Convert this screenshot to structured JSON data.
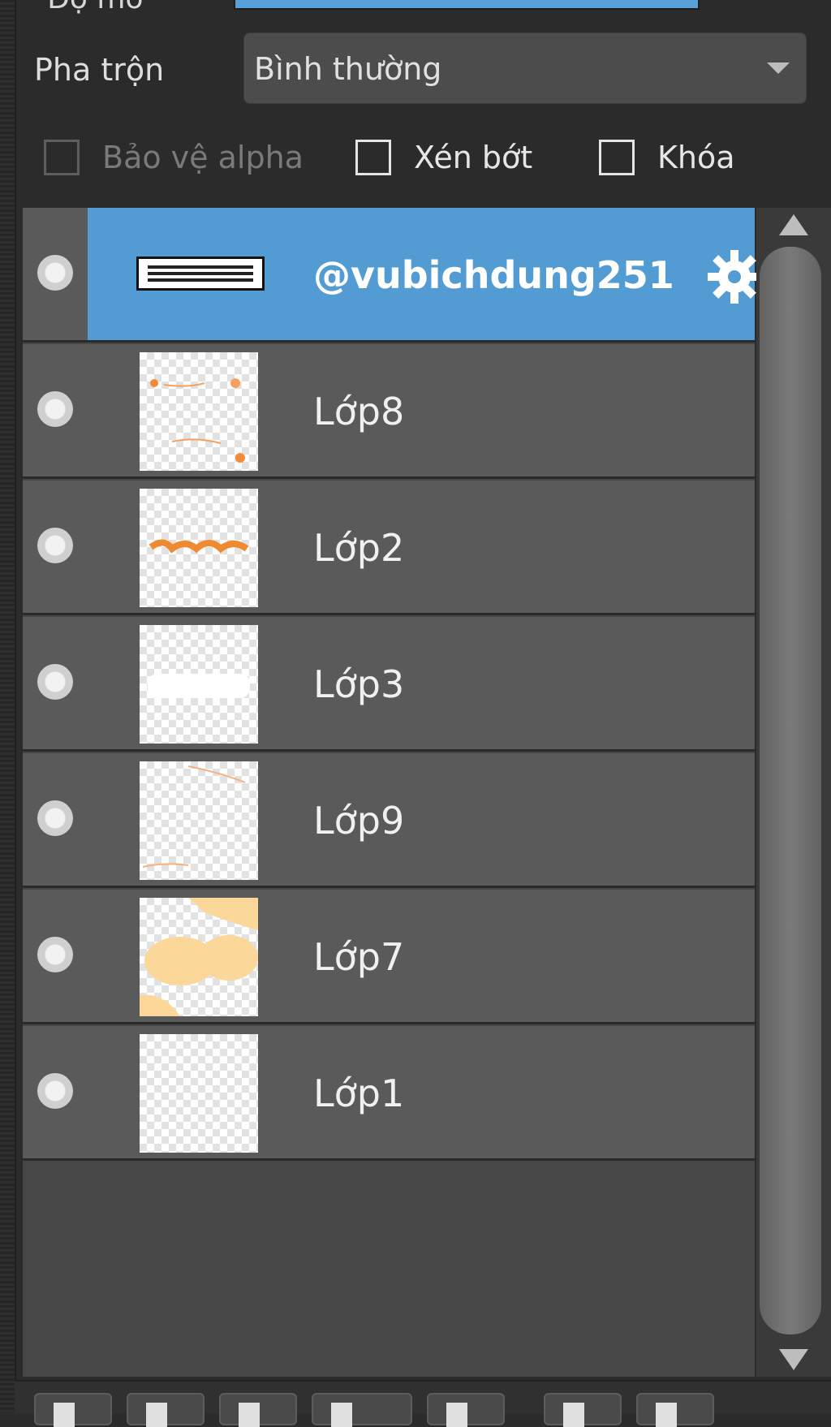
{
  "top": {
    "label": "Độ mờ"
  },
  "blend": {
    "label": "Pha trộn",
    "value": "Bình thường"
  },
  "checkboxes": {
    "protect_alpha": "Bảo vệ alpha",
    "clip": "Xén bớt",
    "lock": "Khóa"
  },
  "layers": [
    {
      "name": "@vubichdung251",
      "selected": true
    },
    {
      "name": "Lớp8"
    },
    {
      "name": "Lớp2"
    },
    {
      "name": "Lớp3"
    },
    {
      "name": "Lớp9"
    },
    {
      "name": "Lớp7"
    },
    {
      "name": "Lớp1"
    }
  ],
  "icons": {
    "layer_settings": "gear-icon",
    "scroll_up": "triangle-up-icon",
    "scroll_down": "triangle-down-icon",
    "select_arrow": "chevron-down-icon"
  },
  "colors": {
    "selection": "#539bd3",
    "panel_bg": "#2b2b2b",
    "row_bg": "#5a5a5a"
  }
}
